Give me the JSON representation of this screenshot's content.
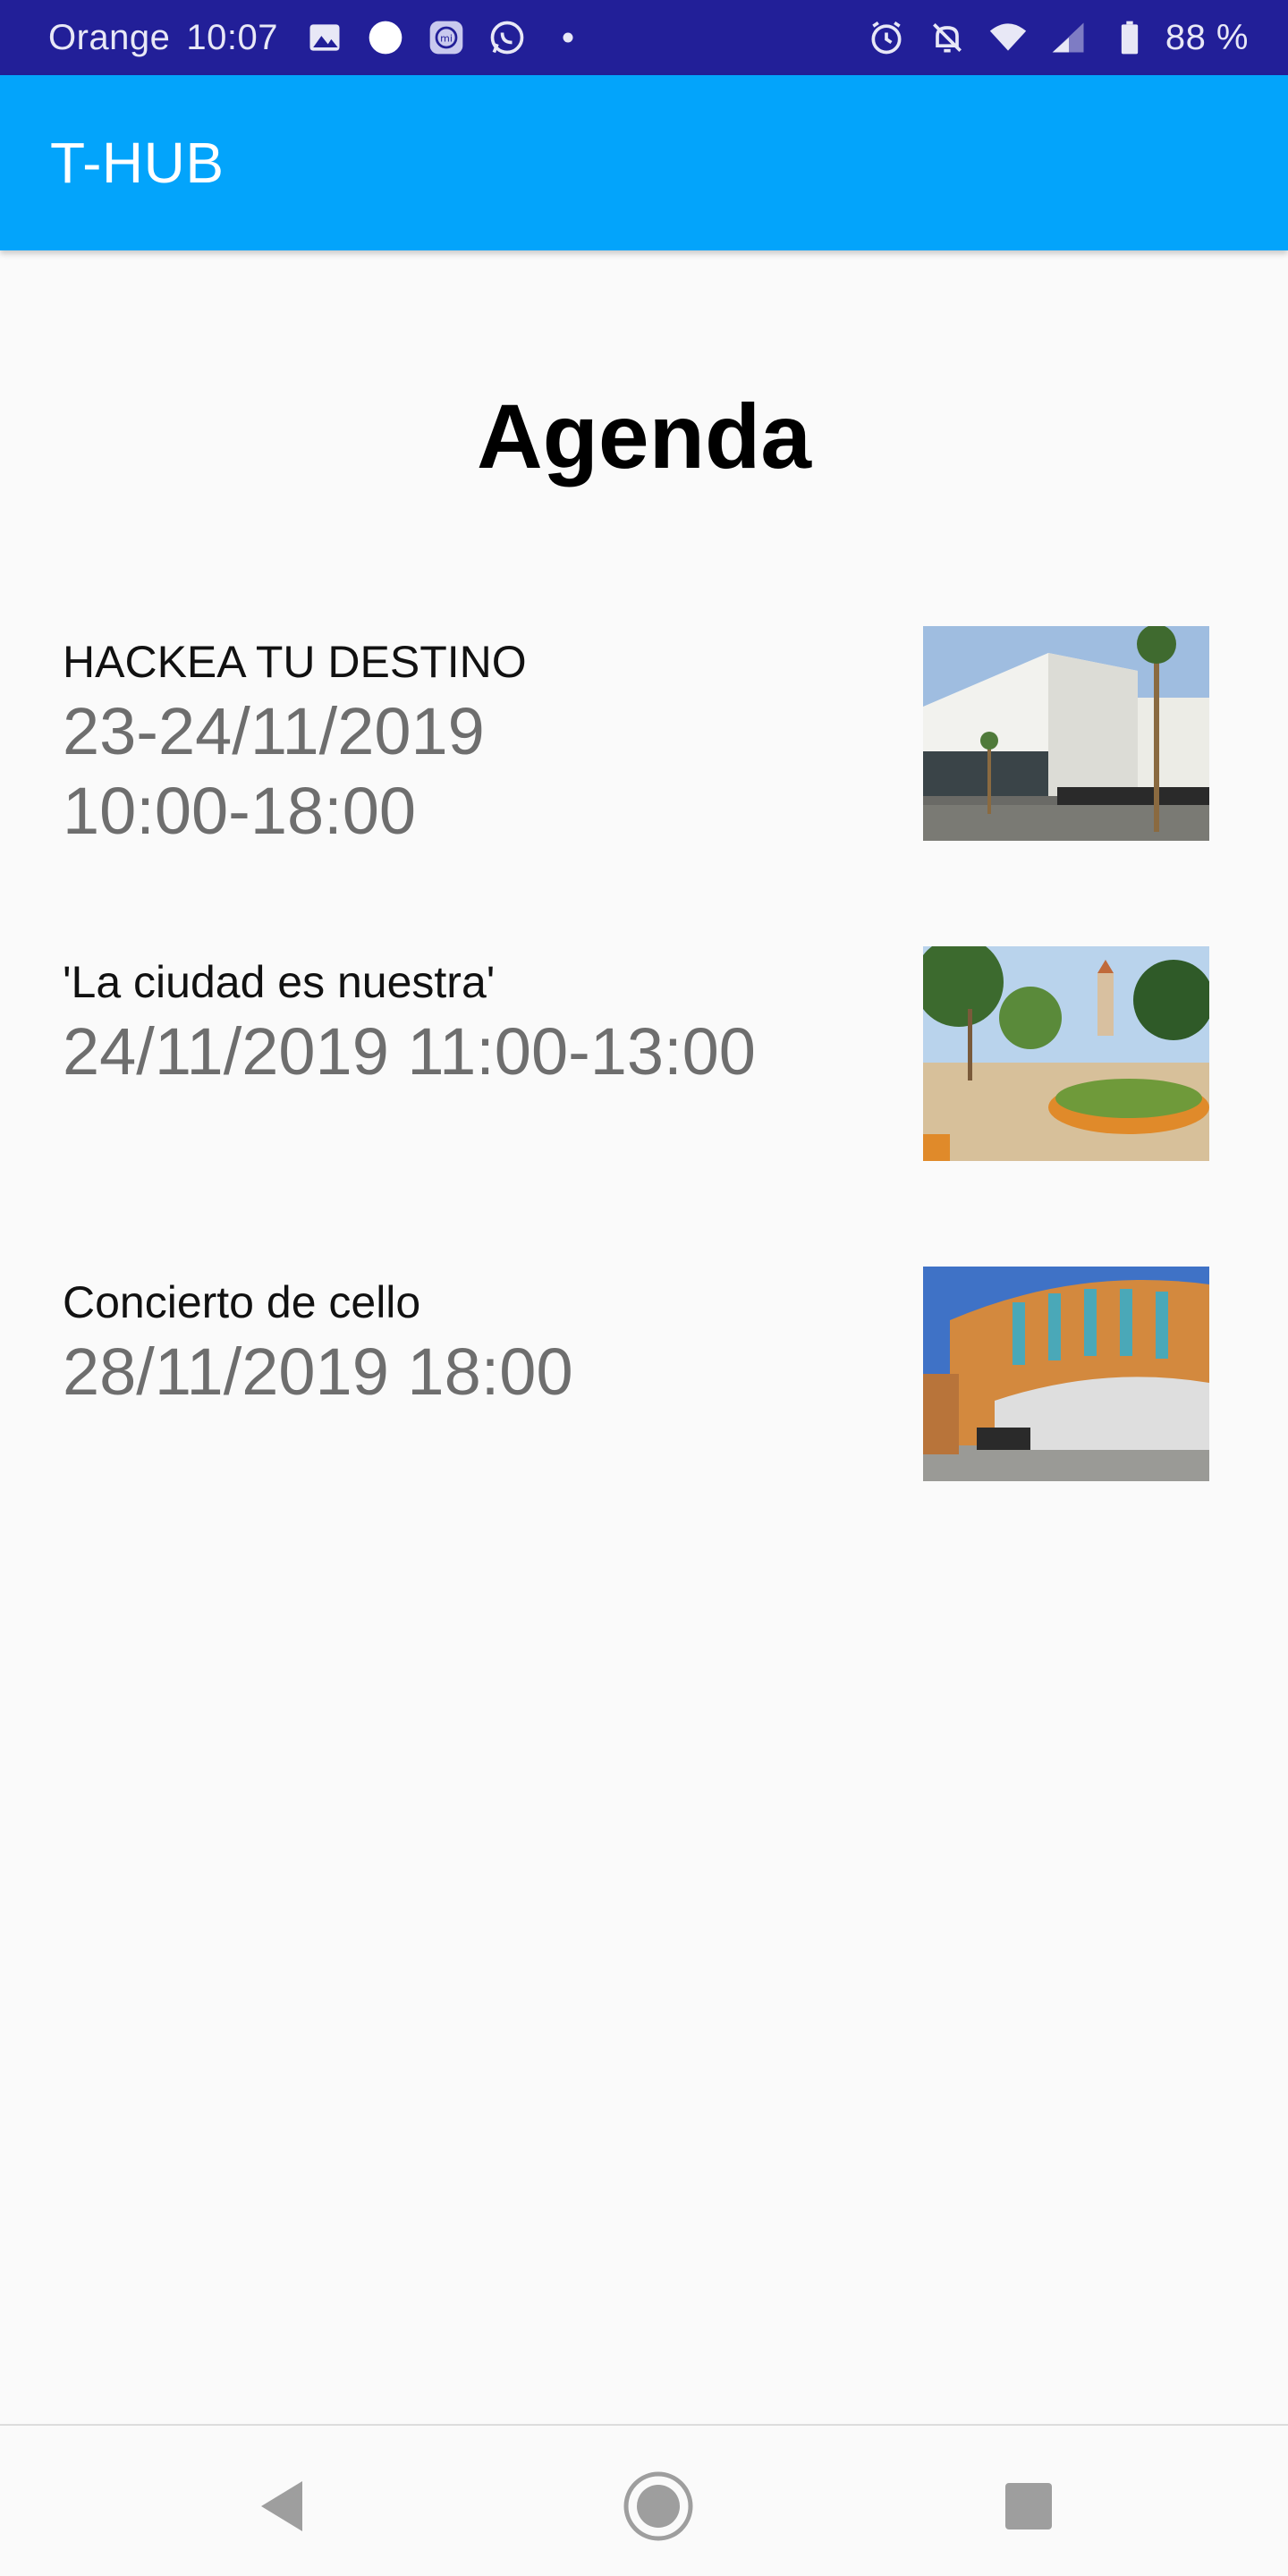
{
  "status_bar": {
    "carrier": "Orange",
    "time": "10:07",
    "battery": "88 %",
    "left_icons": [
      "gallery-icon",
      "circle-icon",
      "mi-icon",
      "whatsapp-icon",
      "dot-icon"
    ],
    "right_icons": [
      "alarm-icon",
      "bell-off-icon",
      "wifi-icon",
      "signal-icon",
      "battery-icon"
    ]
  },
  "app_bar": {
    "title": "T-HUB",
    "color": "#03a4fb"
  },
  "page": {
    "title": "Agenda"
  },
  "agenda": [
    {
      "title": "HACKEA TU DESTINO",
      "date": "23-24/11/2019\n 10:00-18:00",
      "image": "modern-building-photo"
    },
    {
      "title": "'La ciudad es nuestra'",
      "date": "24/11/2019 11:00-13:00",
      "image": "town-square-photo"
    },
    {
      "title": "Concierto de cello",
      "date": "28/11/2019 18:00",
      "image": "auditorium-photo"
    }
  ],
  "nav_bar": {
    "icons": [
      "back-icon",
      "home-icon",
      "recents-icon"
    ]
  }
}
